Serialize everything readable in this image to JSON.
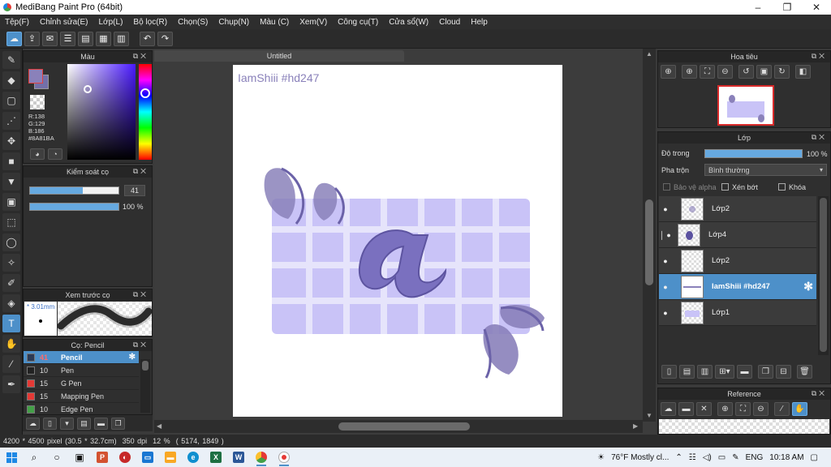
{
  "window": {
    "title": "MediBang Paint Pro (64bit)",
    "minimize": "–",
    "restore": "❐",
    "close": "✕"
  },
  "menu": [
    "Tệp(F)",
    "Chỉnh sửa(E)",
    "Lớp(L)",
    "Bộ lọc(R)",
    "Chọn(S)",
    "Chụp(N)",
    "Màu (C)",
    "Xem(V)",
    "Công cụ(T)",
    "Cửa sổ(W)",
    "Cloud",
    "Help"
  ],
  "color_panel": {
    "title": "Màu",
    "r": "R:138",
    "g": "G:129",
    "b": "B:186",
    "hex": "#8A81BA",
    "current_color": "#8A81BA"
  },
  "brush_control": {
    "title": "Kiểm soát cọ",
    "size_value": "41",
    "size_fraction": 0.6,
    "opacity_label": "100 %",
    "opacity_fraction": 1.0
  },
  "brush_preview": {
    "title": "Xem trước cọ",
    "size_label": "* 3.01mm"
  },
  "brush_list": {
    "title": "Cọ: Pencil",
    "items": [
      {
        "num": "41",
        "name": "Pencil",
        "color": "#2b3a55",
        "selected": true
      },
      {
        "num": "10",
        "name": "Pen",
        "color": "#222222",
        "selected": false
      },
      {
        "num": "15",
        "name": "G Pen",
        "color": "#e53935",
        "selected": false
      },
      {
        "num": "15",
        "name": "Mapping Pen",
        "color": "#e53935",
        "selected": false
      },
      {
        "num": "10",
        "name": "Edge Pen",
        "color": "#43a047",
        "selected": false
      }
    ]
  },
  "canvas": {
    "tab": "Untitled",
    "watermark": "IamShiii #hd247",
    "accent_fill": "#c9c3f7",
    "accent_stroke": "#8A81BA",
    "letter": "a"
  },
  "navigator": {
    "title": "Hoa tiêu"
  },
  "layers": {
    "title": "Lớp",
    "opacity_label": "Độ trong",
    "opacity_value": "100 %",
    "opacity_fraction": 1.0,
    "blend_label": "Pha trộn",
    "blend_value": "Bình thường",
    "protect_alpha": "Bảo vệ alpha",
    "clipping": "Xén bớt",
    "lock": "Khóa",
    "items": [
      {
        "name": "Lớp2",
        "selected": false,
        "visible": true
      },
      {
        "name": "Lớp4",
        "selected": false,
        "visible": true
      },
      {
        "name": "Lớp2",
        "selected": false,
        "visible": true
      },
      {
        "name": "IamShiii #hd247",
        "selected": true,
        "visible": true
      },
      {
        "name": "Lớp1",
        "selected": false,
        "visible": true
      }
    ]
  },
  "reference": {
    "title": "Reference"
  },
  "status": {
    "dimensions": "4200 * 4500 pixel",
    "size_cm": "(30.5 * 32.7cm)",
    "dpi": "350 dpi",
    "zoom": "12 %",
    "coords": "( 5174, 1849 )"
  },
  "taskbar": {
    "weather": "76°F  Mostly cl...",
    "lang": "ENG",
    "time": "10:18 AM"
  }
}
